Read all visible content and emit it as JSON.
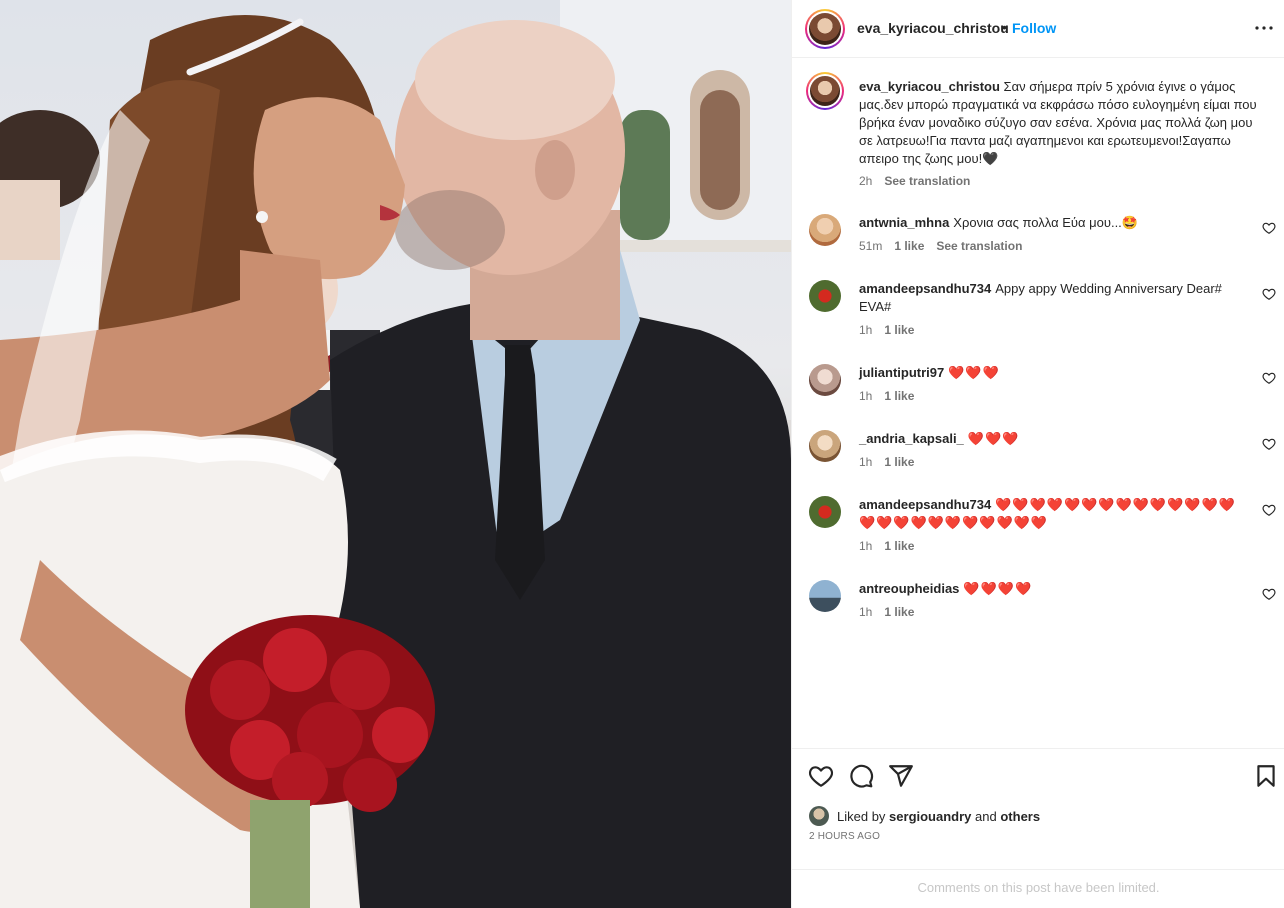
{
  "post": {
    "author": "eva_kyriacou_christou",
    "separator": "•",
    "follow_label": "Follow",
    "more_icon": "more-horizontal-icon"
  },
  "caption": {
    "username": "eva_kyriacou_christou",
    "text": "Σαν σήμερα πρίν 5 χρόνια έγινε ο γάμος μας.δεν μπορώ πραγματικά να εκφράσω πόσο ευλογημένη είμαι που βρήκα έναν μοναδικο σύζυγο σαν εσένα. Χρόνια μας πολλά ζωη μου σε λατρευω!Για παντα μαζι αγαπημενοι και ερωτευμενοι!Σαγαπω απειρο της ζωης μου!🖤",
    "time": "2h",
    "see_translation": "See translation"
  },
  "comments": [
    {
      "username": "antwnia_mhna",
      "text": "Χρονια σας πολλα Εύα μου...🤩",
      "time": "51m",
      "likes": "1 like",
      "extra": "See translation",
      "avatar_color": "#d9a979"
    },
    {
      "username": "amandeepsandhu734",
      "text": "Appy appy Wedding Anniversary Dear# EVA#",
      "time": "1h",
      "likes": "1 like",
      "extra": "",
      "avatar_color": "#4f6b2f"
    },
    {
      "username": "juliantiputri97",
      "text": "❤️❤️❤️",
      "time": "1h",
      "likes": "1 like",
      "extra": "",
      "avatar_color": "#b99a8e"
    },
    {
      "username": "_andria_kapsali_",
      "text": "❤️❤️❤️",
      "time": "1h",
      "likes": "1 like",
      "extra": "",
      "avatar_color": "#caa57c"
    },
    {
      "username": "amandeepsandhu734",
      "text": "❤️❤️❤️❤️❤️❤️❤️❤️❤️❤️❤️❤️❤️❤️❤️❤️❤️❤️❤️❤️❤️❤️❤️❤️❤️",
      "time": "1h",
      "likes": "1 like",
      "extra": "",
      "avatar_color": "#4f6b2f"
    },
    {
      "username": "antreoupheidias",
      "text": "❤️❤️❤️❤️",
      "time": "1h",
      "likes": "1 like",
      "extra": "",
      "avatar_color": "#5a7fa3"
    }
  ],
  "actions": {
    "like_icon": "heart-outline-icon",
    "comment_icon": "comment-icon",
    "share_icon": "share-icon",
    "save_icon": "bookmark-icon",
    "liked_by_prefix": "Liked by",
    "liked_by_user": "sergiouandry",
    "liked_by_and": "and",
    "liked_by_others": "others",
    "time_ago": "2 HOURS AGO",
    "comments_limited": "Comments on this post have been limited."
  },
  "colors": {
    "accent": "#0095f6",
    "text": "#262626",
    "secondary": "#737373",
    "heart": "#e0245e"
  }
}
